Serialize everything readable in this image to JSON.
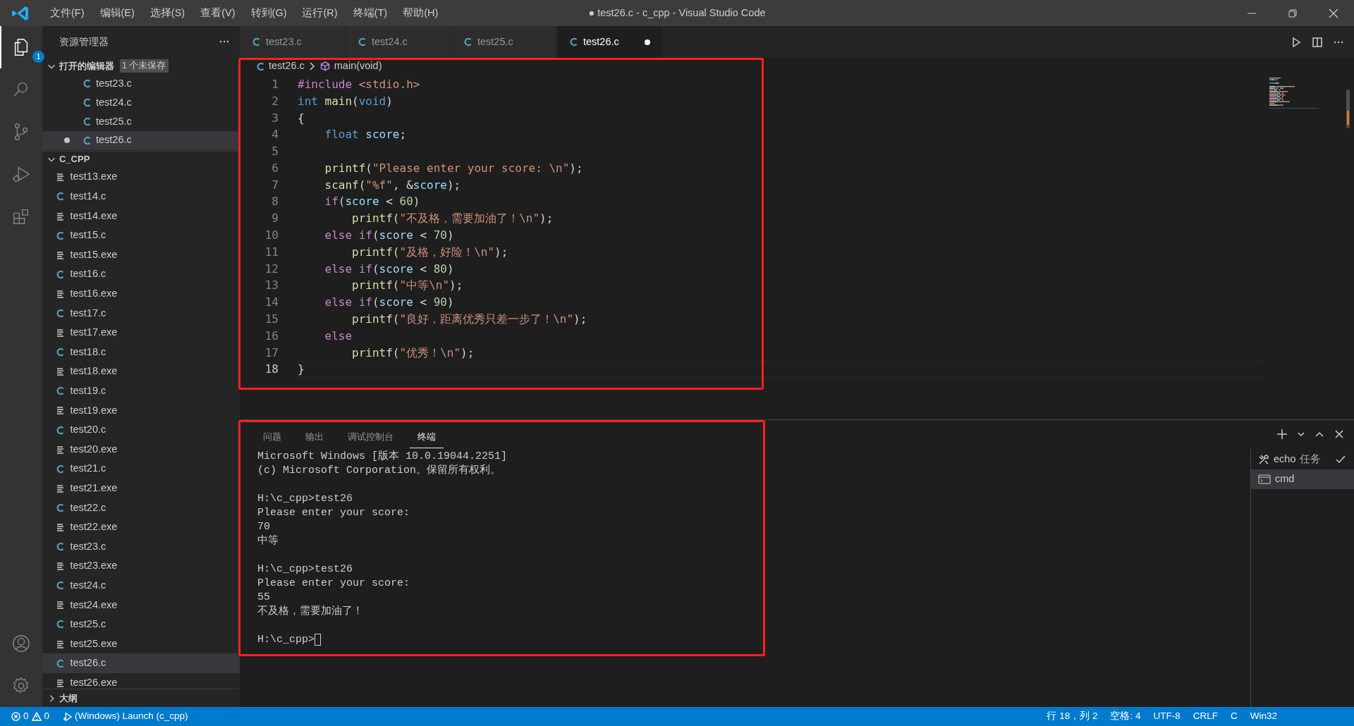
{
  "title_bar": {
    "menus": [
      "文件(F)",
      "编辑(E)",
      "选择(S)",
      "查看(V)",
      "转到(G)",
      "运行(R)",
      "终端(T)",
      "帮助(H)"
    ],
    "title": "● test26.c - c_cpp - Visual Studio Code"
  },
  "activity_bar": [
    {
      "kind": "explorer",
      "selected": true,
      "badge": "1"
    },
    {
      "kind": "search",
      "selected": false
    },
    {
      "kind": "scm",
      "selected": false
    },
    {
      "kind": "debug",
      "selected": false
    },
    {
      "kind": "extensions",
      "selected": false
    },
    {
      "kind": "account",
      "selected": false
    },
    {
      "kind": "settings",
      "selected": false
    }
  ],
  "sidebar": {
    "title": "资源管理器",
    "open_editors": {
      "label": "打开的编辑器",
      "badge": "1 个未保存",
      "expanded": true,
      "items": [
        {
          "name": "test23.c",
          "dirty": false,
          "selected": false
        },
        {
          "name": "test24.c",
          "dirty": false,
          "selected": false
        },
        {
          "name": "test25.c",
          "dirty": false,
          "selected": false
        },
        {
          "name": "test26.c",
          "dirty": true,
          "selected": true
        }
      ]
    },
    "folder": {
      "label": "C_CPP",
      "expanded": true,
      "items": [
        {
          "name": "test13.exe",
          "kind": "exe",
          "selected": false
        },
        {
          "name": "test14.c",
          "kind": "c",
          "selected": false
        },
        {
          "name": "test14.exe",
          "kind": "exe",
          "selected": false
        },
        {
          "name": "test15.c",
          "kind": "c",
          "selected": false
        },
        {
          "name": "test15.exe",
          "kind": "exe",
          "selected": false
        },
        {
          "name": "test16.c",
          "kind": "c",
          "selected": false
        },
        {
          "name": "test16.exe",
          "kind": "exe",
          "selected": false
        },
        {
          "name": "test17.c",
          "kind": "c",
          "selected": false
        },
        {
          "name": "test17.exe",
          "kind": "exe",
          "selected": false
        },
        {
          "name": "test18.c",
          "kind": "c",
          "selected": false
        },
        {
          "name": "test18.exe",
          "kind": "exe",
          "selected": false
        },
        {
          "name": "test19.c",
          "kind": "c",
          "selected": false
        },
        {
          "name": "test19.exe",
          "kind": "exe",
          "selected": false
        },
        {
          "name": "test20.c",
          "kind": "c",
          "selected": false
        },
        {
          "name": "test20.exe",
          "kind": "exe",
          "selected": false
        },
        {
          "name": "test21.c",
          "kind": "c",
          "selected": false
        },
        {
          "name": "test21.exe",
          "kind": "exe",
          "selected": false
        },
        {
          "name": "test22.c",
          "kind": "c",
          "selected": false
        },
        {
          "name": "test22.exe",
          "kind": "exe",
          "selected": false
        },
        {
          "name": "test23.c",
          "kind": "c",
          "selected": false
        },
        {
          "name": "test23.exe",
          "kind": "exe",
          "selected": false
        },
        {
          "name": "test24.c",
          "kind": "c",
          "selected": false
        },
        {
          "name": "test24.exe",
          "kind": "exe",
          "selected": false
        },
        {
          "name": "test25.c",
          "kind": "c",
          "selected": false
        },
        {
          "name": "test25.exe",
          "kind": "exe",
          "selected": false
        },
        {
          "name": "test26.c",
          "kind": "c",
          "selected": true
        },
        {
          "name": "test26.exe",
          "kind": "exe",
          "selected": false
        }
      ]
    },
    "outline": {
      "label": "大纲",
      "expanded": false
    }
  },
  "editor_tabs": [
    {
      "label": "test23.c",
      "selected": false,
      "dirty": false
    },
    {
      "label": "test24.c",
      "selected": false,
      "dirty": false
    },
    {
      "label": "test25.c",
      "selected": false,
      "dirty": false
    },
    {
      "label": "test26.c",
      "selected": true,
      "dirty": true
    }
  ],
  "breadcrumb": {
    "file": "test26.c",
    "symbol": "main(void)"
  },
  "editor": {
    "highlighted": true,
    "lines": [
      {
        "number": "1",
        "current": false,
        "tokens": [
          {
            "kind": "pp",
            "text": "#include"
          },
          {
            "kind": "str",
            "text": " <stdio.h>"
          }
        ]
      },
      {
        "number": "2",
        "current": false,
        "tokens": [
          {
            "kind": "type",
            "text": "int"
          },
          {
            "kind": "func",
            "text": " main"
          },
          {
            "kind": "plain",
            "text": "("
          },
          {
            "kind": "type",
            "text": "void"
          },
          {
            "kind": "plain",
            "text": ")"
          }
        ]
      },
      {
        "number": "3",
        "current": false,
        "tokens": [
          {
            "kind": "plain",
            "text": "{"
          }
        ]
      },
      {
        "number": "4",
        "current": false,
        "tokens": [
          {
            "kind": "type",
            "text": "    float"
          },
          {
            "kind": "var",
            "text": " score"
          },
          {
            "kind": "plain",
            "text": ";"
          }
        ]
      },
      {
        "number": "5",
        "current": false
      },
      {
        "number": "6",
        "current": false,
        "tokens": [
          {
            "kind": "func",
            "text": "    printf"
          },
          {
            "kind": "plain",
            "text": "("
          },
          {
            "kind": "str",
            "text": "\"Please enter your score: \\n\""
          },
          {
            "kind": "plain",
            "text": ");"
          }
        ]
      },
      {
        "number": "7",
        "current": false,
        "tokens": [
          {
            "kind": "func",
            "text": "    scanf"
          },
          {
            "kind": "plain",
            "text": "("
          },
          {
            "kind": "str",
            "text": "\"%f\""
          },
          {
            "kind": "plain",
            "text": ", &"
          },
          {
            "kind": "var",
            "text": "score"
          },
          {
            "kind": "plain",
            "text": ");"
          }
        ]
      },
      {
        "number": "8",
        "current": false,
        "tokens": [
          {
            "kind": "ctrl",
            "text": "    if"
          },
          {
            "kind": "plain",
            "text": "("
          },
          {
            "kind": "var",
            "text": "score"
          },
          {
            "kind": "plain",
            "text": " < "
          },
          {
            "kind": "num",
            "text": "60"
          },
          {
            "kind": "plain",
            "text": ")"
          }
        ]
      },
      {
        "number": "9",
        "current": false,
        "tokens": [
          {
            "kind": "func",
            "text": "        printf"
          },
          {
            "kind": "plain",
            "text": "("
          },
          {
            "kind": "str",
            "text": "\"不及格，需要加油了！\\n\""
          },
          {
            "kind": "plain",
            "text": ");"
          }
        ]
      },
      {
        "number": "10",
        "current": false,
        "tokens": [
          {
            "kind": "ctrl",
            "text": "    else if"
          },
          {
            "kind": "plain",
            "text": "("
          },
          {
            "kind": "var",
            "text": "score"
          },
          {
            "kind": "plain",
            "text": " < "
          },
          {
            "kind": "num",
            "text": "70"
          },
          {
            "kind": "plain",
            "text": ")"
          }
        ]
      },
      {
        "number": "11",
        "current": false,
        "tokens": [
          {
            "kind": "func",
            "text": "        printf"
          },
          {
            "kind": "plain",
            "text": "("
          },
          {
            "kind": "str",
            "text": "\"及格，好险！\\n\""
          },
          {
            "kind": "plain",
            "text": ");"
          }
        ]
      },
      {
        "number": "12",
        "current": false,
        "tokens": [
          {
            "kind": "ctrl",
            "text": "    else if"
          },
          {
            "kind": "plain",
            "text": "("
          },
          {
            "kind": "var",
            "text": "score"
          },
          {
            "kind": "plain",
            "text": " < "
          },
          {
            "kind": "num",
            "text": "80"
          },
          {
            "kind": "plain",
            "text": ")"
          }
        ]
      },
      {
        "number": "13",
        "current": false,
        "tokens": [
          {
            "kind": "func",
            "text": "        printf"
          },
          {
            "kind": "plain",
            "text": "("
          },
          {
            "kind": "str",
            "text": "\"中等\\n\""
          },
          {
            "kind": "plain",
            "text": ");"
          }
        ]
      },
      {
        "number": "14",
        "current": false,
        "tokens": [
          {
            "kind": "ctrl",
            "text": "    else if"
          },
          {
            "kind": "plain",
            "text": "("
          },
          {
            "kind": "var",
            "text": "score"
          },
          {
            "kind": "plain",
            "text": " < "
          },
          {
            "kind": "num",
            "text": "90"
          },
          {
            "kind": "plain",
            "text": ")"
          }
        ]
      },
      {
        "number": "15",
        "current": false,
        "tokens": [
          {
            "kind": "func",
            "text": "        printf"
          },
          {
            "kind": "plain",
            "text": "("
          },
          {
            "kind": "str",
            "text": "\"良好，距离优秀只差一步了！\\n\""
          },
          {
            "kind": "plain",
            "text": ");"
          }
        ]
      },
      {
        "number": "16",
        "current": false,
        "tokens": [
          {
            "kind": "ctrl",
            "text": "    else"
          }
        ]
      },
      {
        "number": "17",
        "current": false,
        "tokens": [
          {
            "kind": "func",
            "text": "        printf"
          },
          {
            "kind": "plain",
            "text": "("
          },
          {
            "kind": "str",
            "text": "\"优秀！\\n\""
          },
          {
            "kind": "plain",
            "text": ");"
          }
        ]
      },
      {
        "number": "18",
        "current": true,
        "tokens": [
          {
            "kind": "plain",
            "text": "}"
          }
        ]
      }
    ]
  },
  "panel": {
    "highlighted": true,
    "tabs": [
      {
        "label": "问题",
        "selected": false
      },
      {
        "label": "输出",
        "selected": false
      },
      {
        "label": "调试控制台",
        "selected": false
      },
      {
        "label": "终端",
        "selected": true
      }
    ],
    "terminal_blocks": [
      [
        "Microsoft Windows [版本 10.0.19044.2251]",
        "(c) Microsoft Corporation。保留所有权利。"
      ],
      [
        "H:\\c_cpp>test26",
        "Please enter your score:",
        "70",
        "中等"
      ],
      [
        "H:\\c_cpp>test26",
        "Please enter your score:",
        "55",
        "不及格，需要加油了！"
      ],
      [
        "H:\\c_cpp>"
      ]
    ],
    "instances": [
      {
        "kind": "task",
        "label": "echo",
        "detail": "任务",
        "selected": false
      },
      {
        "kind": "cmd",
        "label": "cmd",
        "selected": true
      }
    ]
  },
  "status_bar": {
    "errors": "0",
    "warnings": "0",
    "launch": "(Windows) Launch (c_cpp)",
    "right": [
      "行 18，列 2",
      "空格: 4",
      "UTF-8",
      "CRLF",
      "C",
      "Win32"
    ]
  }
}
